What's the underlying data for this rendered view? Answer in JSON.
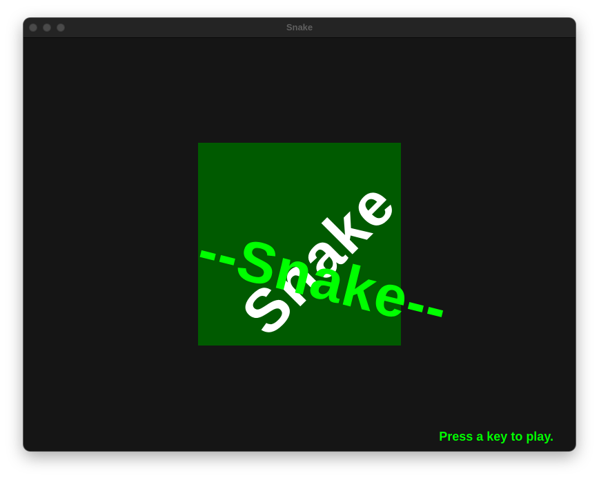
{
  "window": {
    "title": "Snake"
  },
  "game": {
    "logo_word": "Snake",
    "logo_banner": "--Snake--",
    "prompt": "Press a key to play."
  },
  "colors": {
    "background": "#151515",
    "logo_box": "#005a00",
    "accent_green": "#00ff00",
    "logo_white": "#ffffff"
  }
}
